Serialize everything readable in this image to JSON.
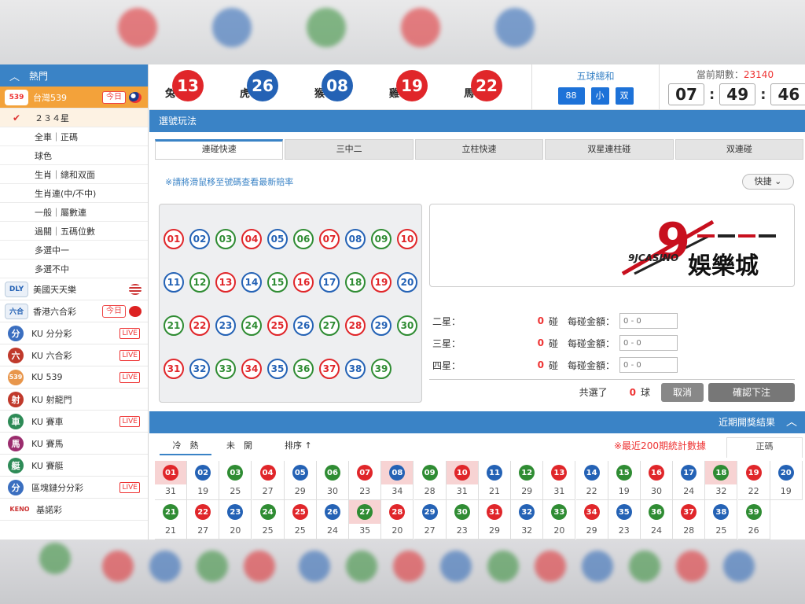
{
  "colors": {
    "red": "#e0262a",
    "blue": "#2462b5",
    "green": "#2f8c33",
    "accent": "#3a83c6",
    "orange": "#f3a23a"
  },
  "sidebar": {
    "header": "熱門",
    "lotteries_top": [
      {
        "name": "台灣539",
        "badge": "今日",
        "logo": "539",
        "active": true
      }
    ],
    "sub_items": [
      {
        "label": "２３４星",
        "checked": true
      },
      {
        "label": "全車｜正碼"
      },
      {
        "label": "球色"
      },
      {
        "label": "生肖｜總和双面"
      },
      {
        "label": "生肖連(中/不中)"
      },
      {
        "label": "一般｜屬數連"
      },
      {
        "label": "過關｜五碼位數"
      },
      {
        "label": "多選中一"
      },
      {
        "label": "多選不中"
      }
    ],
    "lotteries": [
      {
        "name": "美國天天樂",
        "logo": "DLY",
        "flag": "us"
      },
      {
        "name": "香港六合彩",
        "logo": "六合",
        "badge": "今日",
        "flag": "hk"
      },
      {
        "name": "KU 分分彩",
        "icon": "分",
        "live": "LIVE"
      },
      {
        "name": "KU 六合彩",
        "icon": "六",
        "live": "LIVE"
      },
      {
        "name": "KU 539",
        "icon": "539",
        "live": "LIVE"
      },
      {
        "name": "KU 射龍門",
        "icon": "射"
      },
      {
        "name": "KU 賽車",
        "icon": "車",
        "live": "LIVE"
      },
      {
        "name": "KU 賽馬",
        "icon": "馬"
      },
      {
        "name": "KU 賽艇",
        "icon": "艇"
      },
      {
        "name": "區塊鏈分分彩",
        "icon": "分",
        "live": "LIVE"
      },
      {
        "name": "基諾彩",
        "icon": "KENO"
      }
    ]
  },
  "draw": [
    {
      "zodiac": "兔",
      "num": "13",
      "color": "red"
    },
    {
      "zodiac": "虎",
      "num": "26",
      "color": "blue"
    },
    {
      "zodiac": "猴",
      "num": "08",
      "color": "blue"
    },
    {
      "zodiac": "雞",
      "num": "19",
      "color": "red"
    },
    {
      "zodiac": "馬",
      "num": "22",
      "color": "red"
    }
  ],
  "sum": {
    "title": "五球總和",
    "total": "88",
    "size": "小",
    "parity": "双"
  },
  "period": {
    "label": "當前期數：",
    "value": "23140"
  },
  "timer": {
    "hh": "07",
    "mm": "49",
    "ss": "46"
  },
  "panel_title": "選號玩法",
  "tabs": [
    "連碰快速",
    "三中二",
    "立柱快速",
    "双星連柱碰",
    "双連碰"
  ],
  "hint": "※請將滑鼠移至號碼查看最新賠率",
  "quick_label": "快捷",
  "numbers": [
    "01",
    "02",
    "03",
    "04",
    "05",
    "06",
    "07",
    "08",
    "09",
    "10",
    "11",
    "12",
    "13",
    "14",
    "15",
    "16",
    "17",
    "18",
    "19",
    "20",
    "21",
    "22",
    "23",
    "24",
    "25",
    "26",
    "27",
    "28",
    "29",
    "30",
    "31",
    "32",
    "33",
    "34",
    "35",
    "36",
    "37",
    "38",
    "39"
  ],
  "number_colors": [
    "red",
    "blue",
    "green",
    "red",
    "blue",
    "green",
    "red",
    "blue",
    "green",
    "red",
    "blue",
    "green",
    "red",
    "blue",
    "green",
    "red",
    "blue",
    "green",
    "red",
    "blue",
    "green",
    "red",
    "blue",
    "green",
    "red",
    "blue",
    "green",
    "red",
    "blue",
    "green",
    "red",
    "blue",
    "green",
    "red",
    "blue",
    "green",
    "red",
    "blue",
    "green"
  ],
  "ad": {
    "brand": "9JCASINO",
    "title": "娛樂城",
    "digit": "9"
  },
  "stars": [
    {
      "label": "二星：",
      "count": "0",
      "unit": "碰",
      "amount_label": "每碰金額：",
      "placeholder": "0 - 0"
    },
    {
      "label": "三星：",
      "count": "0",
      "unit": "碰",
      "amount_label": "每碰金額：",
      "placeholder": "0 - 0"
    },
    {
      "label": "四星：",
      "count": "0",
      "unit": "碰",
      "amount_label": "每碰金額：",
      "placeholder": "0 - 0"
    }
  ],
  "selected": {
    "label": "共選了",
    "count": "0",
    "unit": "球",
    "cancel": "取消",
    "confirm": "確認下注"
  },
  "recent": {
    "title": "近期開獎結果",
    "tab_hot": "冷　熱",
    "tab_unopened": "未　開",
    "sort": "排序",
    "sort_arrow": "↑",
    "note": "※最近200期統計數據",
    "zheng": "正碼",
    "counts": [
      "31",
      "19",
      "25",
      "27",
      "29",
      "30",
      "23",
      "34",
      "28",
      "31",
      "21",
      "29",
      "31",
      "22",
      "19",
      "30",
      "24",
      "32",
      "22",
      "19",
      "21",
      "27",
      "20",
      "25",
      "25",
      "24",
      "35",
      "20",
      "27",
      "23",
      "29",
      "32",
      "20",
      "29",
      "23",
      "24",
      "28",
      "25",
      "26"
    ],
    "highlight": [
      "01",
      "08",
      "10",
      "18",
      "27"
    ]
  }
}
